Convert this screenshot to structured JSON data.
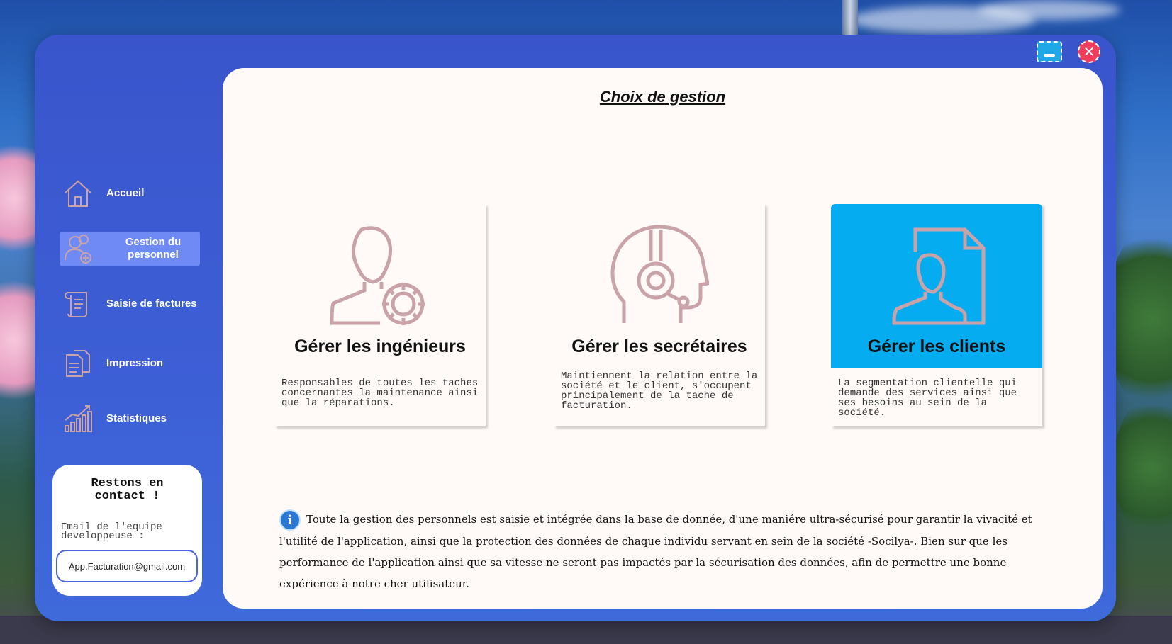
{
  "window": {
    "minimize_icon": "minimize-icon",
    "close_icon": "close-icon"
  },
  "sidebar": {
    "items": [
      {
        "label": "Accueil",
        "icon": "home-icon"
      },
      {
        "label": "Gestion du personnel",
        "icon": "users-add-icon",
        "active": true
      },
      {
        "label": "Saisie de factures",
        "icon": "scroll-icon"
      },
      {
        "label": "Impression",
        "icon": "documents-icon"
      },
      {
        "label": "Statistiques",
        "icon": "chart-icon"
      }
    ],
    "contact": {
      "title": "Restons en contact !",
      "label": "Email de l'equipe developpeuse :",
      "email": "App.Facturation@gmail.com"
    }
  },
  "main": {
    "title": "Choix de gestion",
    "cards": [
      {
        "name": "Gérer les ingénieurs",
        "icon": "engineer-gear-icon",
        "description": "Responsables de toutes les taches concernantes la maintenance ainsi que la réparations."
      },
      {
        "name": "Gérer les secrétaires",
        "icon": "headset-head-icon",
        "description": "Maintiennent la relation entre la société et le client, s'occupent principalement de la tache de facturation."
      },
      {
        "name": "Gérer les clients",
        "icon": "client-document-icon",
        "description": "La segmentation clientelle qui demande des services ainsi que ses besoins au sein de la société.",
        "highlighted": true
      }
    ],
    "info": {
      "icon": "info-icon",
      "text": "Toute la gestion des personnels est saisie et intégrée dans la base de donnée, d'une maniére ultra-sécurisé pour garantir la vivacité et l'utilité de l'application, ainsi que la protection des données de chaque individu servant en sein de la société -Socilya-. Bien sur que les performance de l'application ainsi que sa vitesse ne seront pas impactés par la sécurisation des données, afin de permettre une bonne expérience à notre cher utilisateur."
    }
  },
  "colors": {
    "window": "#3d5fd6",
    "active_nav": "#6f8af5",
    "highlight_card": "#06acf0",
    "icon_stroke": "#c9a3a8",
    "panel": "#fffaf8"
  }
}
